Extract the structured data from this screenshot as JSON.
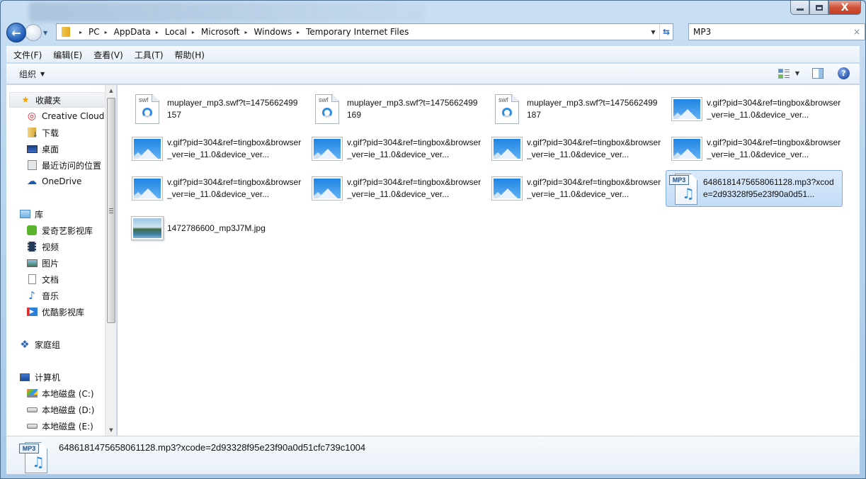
{
  "window": {
    "controls": {
      "minimize": "minimize",
      "maximize": "maximize",
      "close": "X"
    }
  },
  "navigation": {
    "back_glyph": "←",
    "history_arrow": "▼",
    "breadcrumb": [
      "PC",
      "AppData",
      "Local",
      "Microsoft",
      "Windows",
      "Temporary Internet Files"
    ],
    "breadcrumb_sep": "▸",
    "address_dropdown": "▼",
    "refresh_glyph": "⇆"
  },
  "search": {
    "value": "MP3",
    "clear_glyph": "×"
  },
  "menu": {
    "items": [
      "文件(F)",
      "编辑(E)",
      "查看(V)",
      "工具(T)",
      "帮助(H)"
    ]
  },
  "command_bar": {
    "organize": "组织",
    "organize_arrow": "▼",
    "views_arrow": "▼",
    "help_glyph": "?"
  },
  "sidebar": {
    "favorites": {
      "label": "收藏夹",
      "icon": "star-icon",
      "items": [
        {
          "label": "Creative Cloud",
          "icon": "creative-cloud-icon"
        },
        {
          "label": "下载",
          "icon": "downloads-icon"
        },
        {
          "label": "桌面",
          "icon": "desktop-icon"
        },
        {
          "label": "最近访问的位置",
          "icon": "recent-places-icon"
        },
        {
          "label": "OneDrive",
          "icon": "onedrive-icon"
        }
      ]
    },
    "libraries": {
      "label": "库",
      "icon": "library-icon",
      "items": [
        {
          "label": "爱奇艺影视库",
          "icon": "iqiyi-icon"
        },
        {
          "label": "视频",
          "icon": "video-icon"
        },
        {
          "label": "图片",
          "icon": "pictures-icon"
        },
        {
          "label": "文档",
          "icon": "documents-icon"
        },
        {
          "label": "音乐",
          "icon": "music-icon"
        },
        {
          "label": "优酷影视库",
          "icon": "youku-icon"
        }
      ]
    },
    "homegroup": {
      "label": "家庭组",
      "icon": "homegroup-icon"
    },
    "computer": {
      "label": "计算机",
      "icon": "computer-icon",
      "items": [
        {
          "label": "本地磁盘 (C:)",
          "icon": "system-drive-icon"
        },
        {
          "label": "本地磁盘 (D:)",
          "icon": "drive-icon"
        },
        {
          "label": "本地磁盘 (E:)",
          "icon": "drive-icon"
        }
      ]
    }
  },
  "files": [
    {
      "name": "muplayer_mp3.swf?t=1475662499157",
      "type": "swf",
      "selected": false
    },
    {
      "name": "muplayer_mp3.swf?t=1475662499169",
      "type": "swf",
      "selected": false
    },
    {
      "name": "muplayer_mp3.swf?t=1475662499187",
      "type": "swf",
      "selected": false
    },
    {
      "name": "v.gif?pid=304&ref=tingbox&browser_ver=ie_11.0&device_ver...",
      "type": "gif",
      "selected": false
    },
    {
      "name": "v.gif?pid=304&ref=tingbox&browser_ver=ie_11.0&device_ver...",
      "type": "gif",
      "selected": false
    },
    {
      "name": "v.gif?pid=304&ref=tingbox&browser_ver=ie_11.0&device_ver...",
      "type": "gif",
      "selected": false
    },
    {
      "name": "v.gif?pid=304&ref=tingbox&browser_ver=ie_11.0&device_ver...",
      "type": "gif",
      "selected": false
    },
    {
      "name": "v.gif?pid=304&ref=tingbox&browser_ver=ie_11.0&device_ver...",
      "type": "gif",
      "selected": false
    },
    {
      "name": "v.gif?pid=304&ref=tingbox&browser_ver=ie_11.0&device_ver...",
      "type": "gif",
      "selected": false
    },
    {
      "name": "v.gif?pid=304&ref=tingbox&browser_ver=ie_11.0&device_ver...",
      "type": "gif",
      "selected": false
    },
    {
      "name": "v.gif?pid=304&ref=tingbox&browser_ver=ie_11.0&device_ver...",
      "type": "gif",
      "selected": false
    },
    {
      "name": "6486181475658061128.mp3?xcode=2d93328f95e23f90a0d51...",
      "type": "mp3",
      "selected": true
    },
    {
      "name": "1472786600_mp3J7M.jpg",
      "type": "jpg",
      "selected": false
    }
  ],
  "icon_labels": {
    "swf": "swf",
    "mp3": "MP3",
    "note": "♫"
  },
  "details": {
    "name": "6486181475658061128.mp3?xcode=2d93328f95e23f90a0d51cfc739c1004",
    "type": "mp3"
  }
}
